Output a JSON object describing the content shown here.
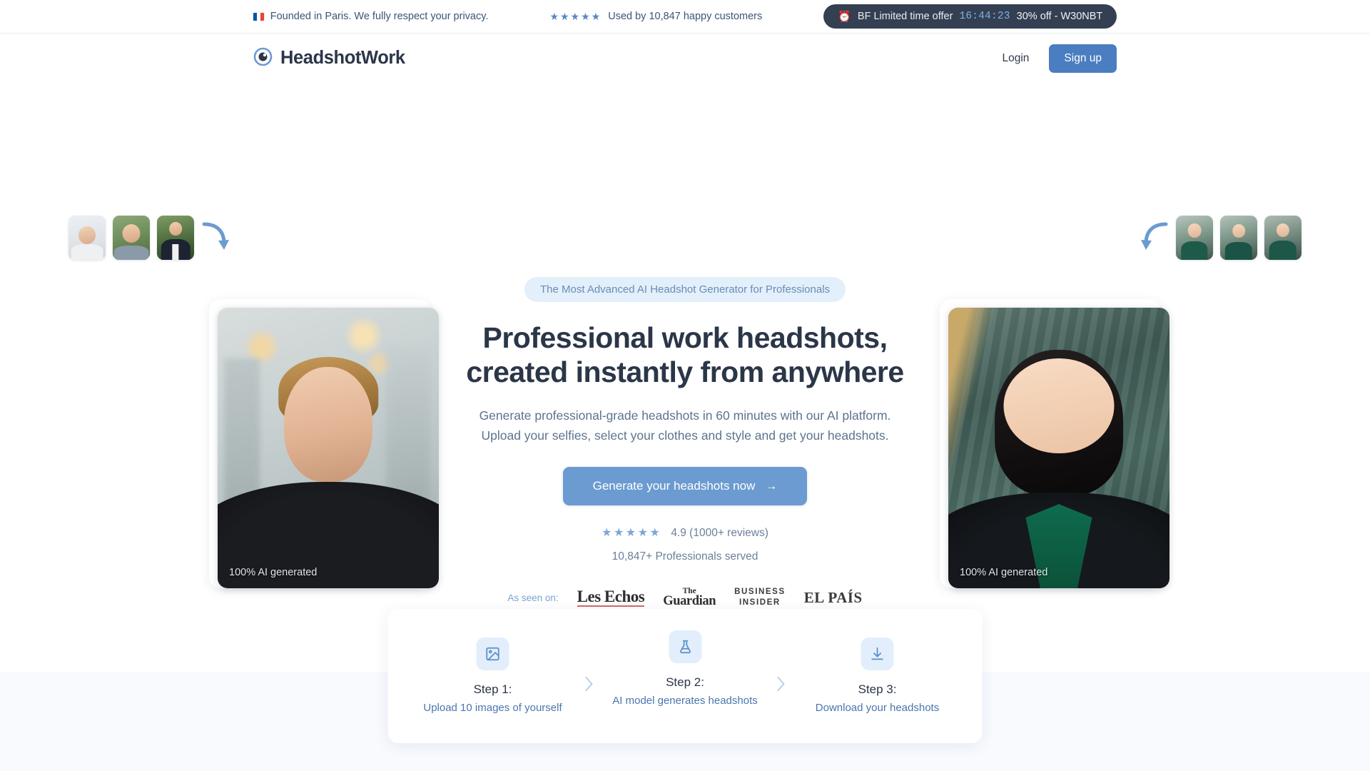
{
  "announcement": {
    "privacy_text": "Founded in Paris. We fully respect your privacy.",
    "flag_icon": "french-flag-icon",
    "stars": "★★★★★",
    "customers_text": "Used by 10,847 happy customers",
    "offer": {
      "icon": "alarm-clock-icon",
      "label": "BF Limited time offer",
      "timer": "16:44:23",
      "discount": "30% off - W30NBT",
      "bg_color": "#343f52",
      "timer_color": "#7fb0e8"
    }
  },
  "header": {
    "logo_icon": "headshotwork-logo-icon",
    "brand": "HeadshotWork",
    "login_label": "Login",
    "signup_label": "Sign up",
    "signup_color": "#4a7ec0"
  },
  "hero": {
    "badge": "The Most Advanced AI Headshot Generator for Professionals",
    "headline": "Professional work headshots, created instantly from anywhere",
    "subhead": "Generate professional-grade headshots in 60 minutes with our AI platform. Upload your selfies, select your clothes and style and get your headshots.",
    "cta_label": "Generate your headshots now",
    "cta_arrow": "→",
    "cta_color": "#6b9bd0",
    "rating": {
      "stars": "★★★★★",
      "score_text": "4.9 (1000+ reviews)"
    },
    "served_text": "10,847+ Professionals served",
    "left_photo_caption": "100% AI generated",
    "right_photo_caption": "100% AI generated",
    "left_photo_alt": "ai-generated-male-headshot",
    "right_photo_alt": "ai-generated-female-headshot",
    "left_arrow_icon": "curved-arrow-down-right-icon",
    "right_arrow_icon": "curved-arrow-down-left-icon",
    "input_thumbnails": [
      "selfie-thumbnail-1",
      "selfie-thumbnail-2",
      "selfie-thumbnail-3"
    ],
    "output_thumbnails": [
      "generated-thumbnail-1",
      "generated-thumbnail-2",
      "generated-thumbnail-3"
    ]
  },
  "press": {
    "label": "As seen on:",
    "outlets": [
      {
        "name": "Les Echos"
      },
      {
        "the": "The",
        "name": "Guardian"
      },
      {
        "line1": "BUSINESS",
        "line2": "INSIDER"
      },
      {
        "name": "EL PAÍS"
      }
    ]
  },
  "steps": {
    "chevron": "›",
    "items": [
      {
        "icon": "image-icon",
        "title": "Step 1:",
        "desc": "Upload 10 images of yourself"
      },
      {
        "icon": "flask-icon",
        "title": "Step 2:",
        "desc": "AI model generates headshots"
      },
      {
        "icon": "download-icon",
        "title": "Step 3:",
        "desc": "Download your headshots"
      }
    ]
  }
}
